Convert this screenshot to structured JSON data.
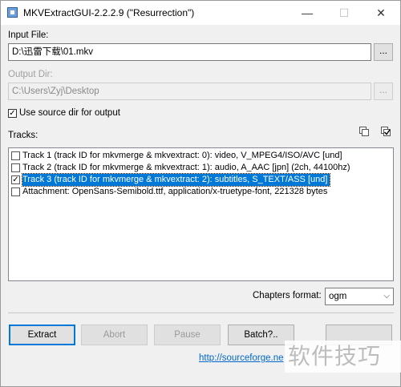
{
  "window": {
    "title": "MKVExtractGUI-2.2.2.9 (\"Resurrection\")",
    "minimize": "—",
    "maximize": "☐",
    "close": "✕"
  },
  "input": {
    "label": "Input File:",
    "value": "D:\\迅雷下载\\01.mkv",
    "browse": "..."
  },
  "output": {
    "label": "Output Dir:",
    "value": "C:\\Users\\Zyj\\Desktop",
    "browse": "..."
  },
  "use_source_dir": {
    "label": "Use source dir for output",
    "checked": true
  },
  "tracks": {
    "label": "Tracks:",
    "items": [
      {
        "text": "Track 1 (track ID for mkvmerge & mkvextract: 0): video, V_MPEG4/ISO/AVC [und]",
        "checked": false,
        "selected": false
      },
      {
        "text": "Track 2 (track ID for mkvmerge & mkvextract: 1): audio, A_AAC [jpn]  (2ch, 44100hz)",
        "checked": false,
        "selected": false
      },
      {
        "text": "Track 3 (track ID for mkvmerge & mkvextract: 2): subtitles, S_TEXT/ASS [und]",
        "checked": true,
        "selected": true
      },
      {
        "text": "Attachment: OpenSans-Semibold.ttf, application/x-truetype-font, 221328 bytes",
        "checked": false,
        "selected": false
      }
    ]
  },
  "chapters": {
    "label": "Chapters format:",
    "value": "ogm"
  },
  "buttons": {
    "extract": "Extract",
    "abort": "Abort",
    "pause": "Pause",
    "batch": "Batch?.."
  },
  "link": "http://sourceforge.ne",
  "watermark": "软件技巧",
  "icons": {
    "app": "app-icon",
    "select_none": "select-none-icon",
    "select_all": "select-all-icon",
    "dropdown": "chevron-down-icon"
  }
}
